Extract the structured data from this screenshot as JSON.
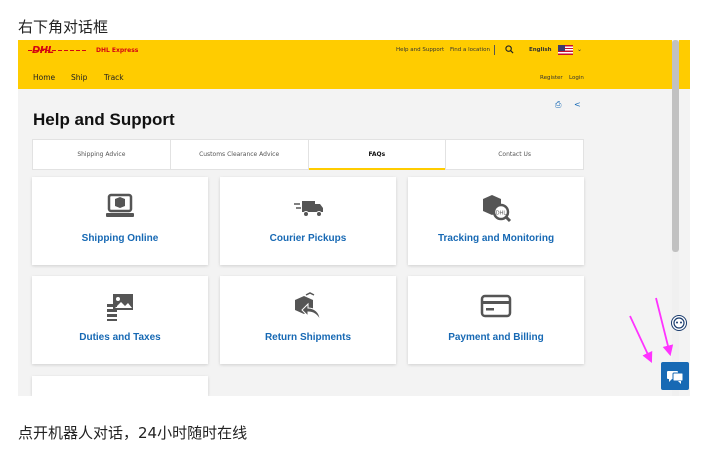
{
  "captions": {
    "top": "右下角对话框",
    "bottom": "点开机器人对话，24小时随时在线"
  },
  "header": {
    "logo": "DHL",
    "brand_name": "DHL Express",
    "help_link": "Help and Support",
    "location_link": "Find a location",
    "language": "English",
    "search_icon": "search-icon",
    "chevron_icon": "chevron-down-icon"
  },
  "nav": {
    "items": [
      "Home",
      "Ship",
      "Track"
    ],
    "register": "Register",
    "login": "Login"
  },
  "page": {
    "title": "Help and Support",
    "print_icon": "print-icon",
    "share_icon": "share-icon"
  },
  "tabs": [
    {
      "label": "Shipping Advice",
      "active": false
    },
    {
      "label": "Customs Clearance Advice",
      "active": false
    },
    {
      "label": "FAQs",
      "active": true
    },
    {
      "label": "Contact Us",
      "active": false
    }
  ],
  "cards": [
    {
      "label": "Shipping Online",
      "icon": "laptop-package-icon"
    },
    {
      "label": "Courier Pickups",
      "icon": "delivery-truck-icon"
    },
    {
      "label": "Tracking and Monitoring",
      "icon": "package-search-icon"
    },
    {
      "label": "Duties and Taxes",
      "icon": "duties-document-icon"
    },
    {
      "label": "Return Shipments",
      "icon": "return-package-icon"
    },
    {
      "label": "Payment and Billing",
      "icon": "credit-card-icon"
    }
  ],
  "widgets": {
    "bot_icon": "chatbot-face-icon",
    "chat_icon": "chat-bubbles-icon",
    "accent_color": "#ff33ff",
    "brand_yellow": "#ffcc00",
    "brand_red": "#d40511",
    "link_blue": "#1769b4"
  }
}
